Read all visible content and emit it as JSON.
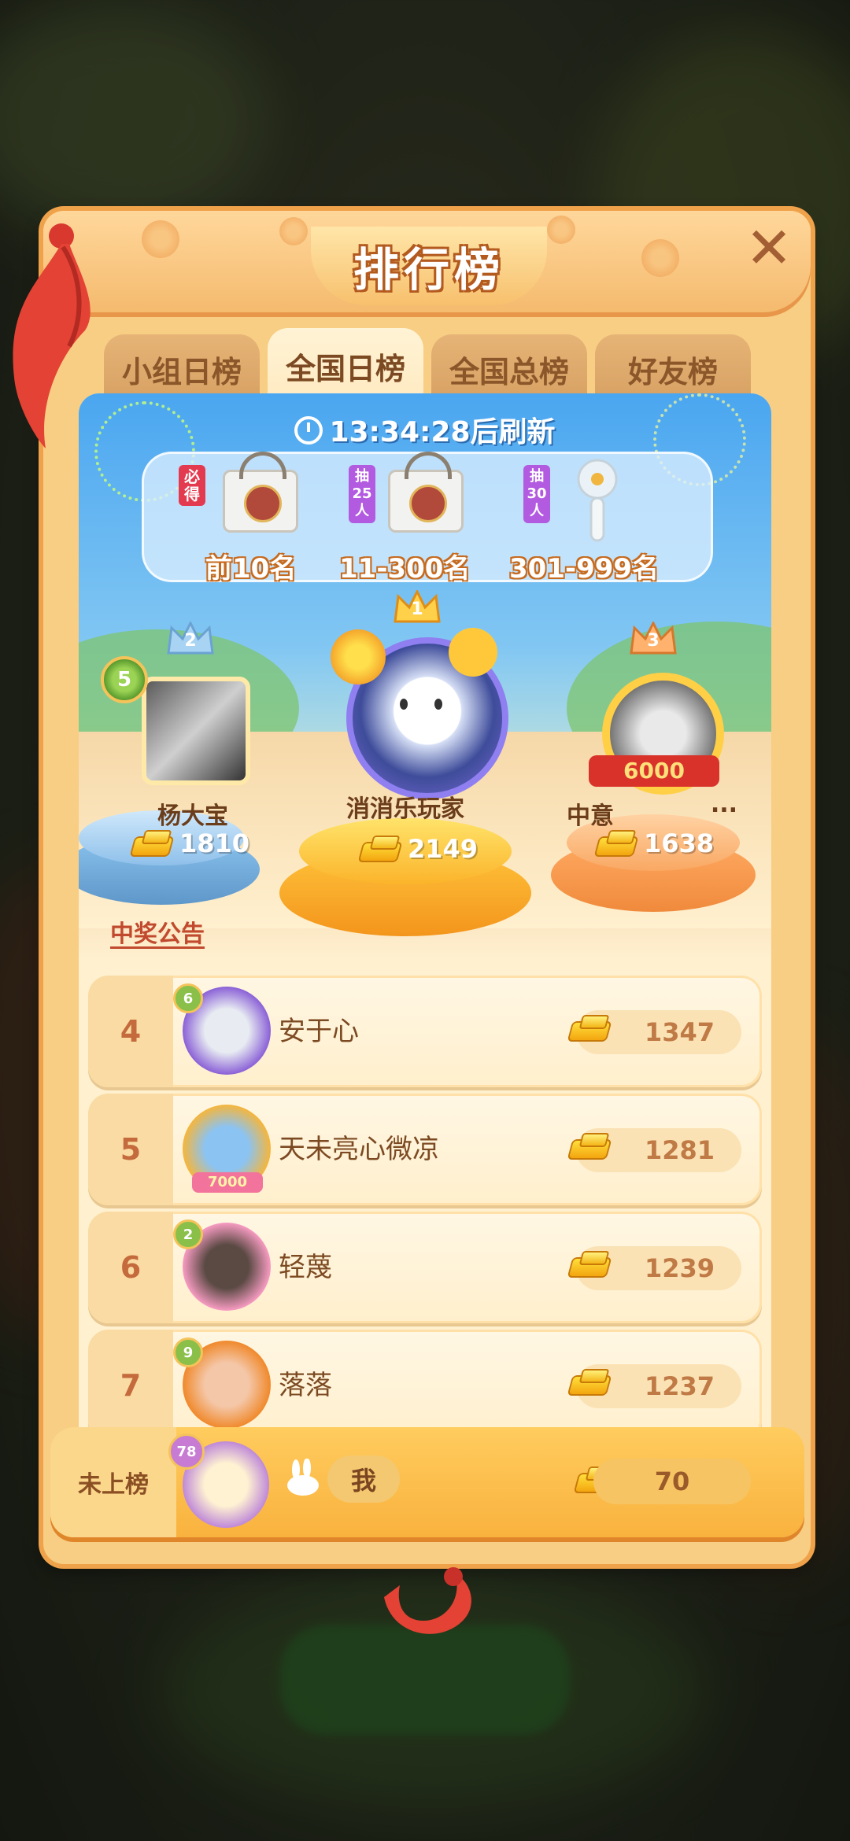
{
  "background": {
    "title": "",
    "button_label": ""
  },
  "panel": {
    "title": "排行榜"
  },
  "tabs": [
    {
      "label": "小组日榜",
      "active": false
    },
    {
      "label": "全国日榜",
      "active": true
    },
    {
      "label": "全国总榜",
      "active": false
    },
    {
      "label": "好友榜",
      "active": false
    }
  ],
  "timer": {
    "time": "13:34:28",
    "suffix": "后刷新"
  },
  "prizes": [
    {
      "tag": "必得",
      "label": "前10名",
      "item_icon": "tote-bag-icon"
    },
    {
      "tag": "抽25人",
      "label": "11-300名",
      "item_icon": "tote-bag-icon"
    },
    {
      "tag": "抽30人",
      "label": "301-999名",
      "item_icon": "handheld-fan-icon"
    }
  ],
  "podium": {
    "first": {
      "rank": "1",
      "name": "消消乐玩家",
      "score": "2149"
    },
    "second": {
      "rank": "2",
      "name": "杨大宝",
      "score": "1810",
      "level": "5"
    },
    "third": {
      "rank": "3",
      "name": "中意",
      "name_suffix": "...",
      "score": "1638",
      "frame_label": "6000"
    }
  },
  "announcement": "中奖公告",
  "ranking": [
    {
      "rank": "4",
      "name": "安于心",
      "score": "1347",
      "level": "6"
    },
    {
      "rank": "5",
      "name": "天未亮心微凉",
      "score": "1281",
      "frame_label": "7000"
    },
    {
      "rank": "6",
      "name": "轻蔑",
      "score": "1239",
      "level": "2"
    },
    {
      "rank": "7",
      "name": "落落",
      "score": "1237",
      "level": "9"
    }
  ],
  "self": {
    "rank_label": "未上榜",
    "name": "我",
    "score": "70",
    "level": "78"
  },
  "colors": {
    "panel": "#f7ce83",
    "accent": "#f0a24a",
    "gold": "#f3a50f",
    "sky": "#4aa6f0"
  }
}
